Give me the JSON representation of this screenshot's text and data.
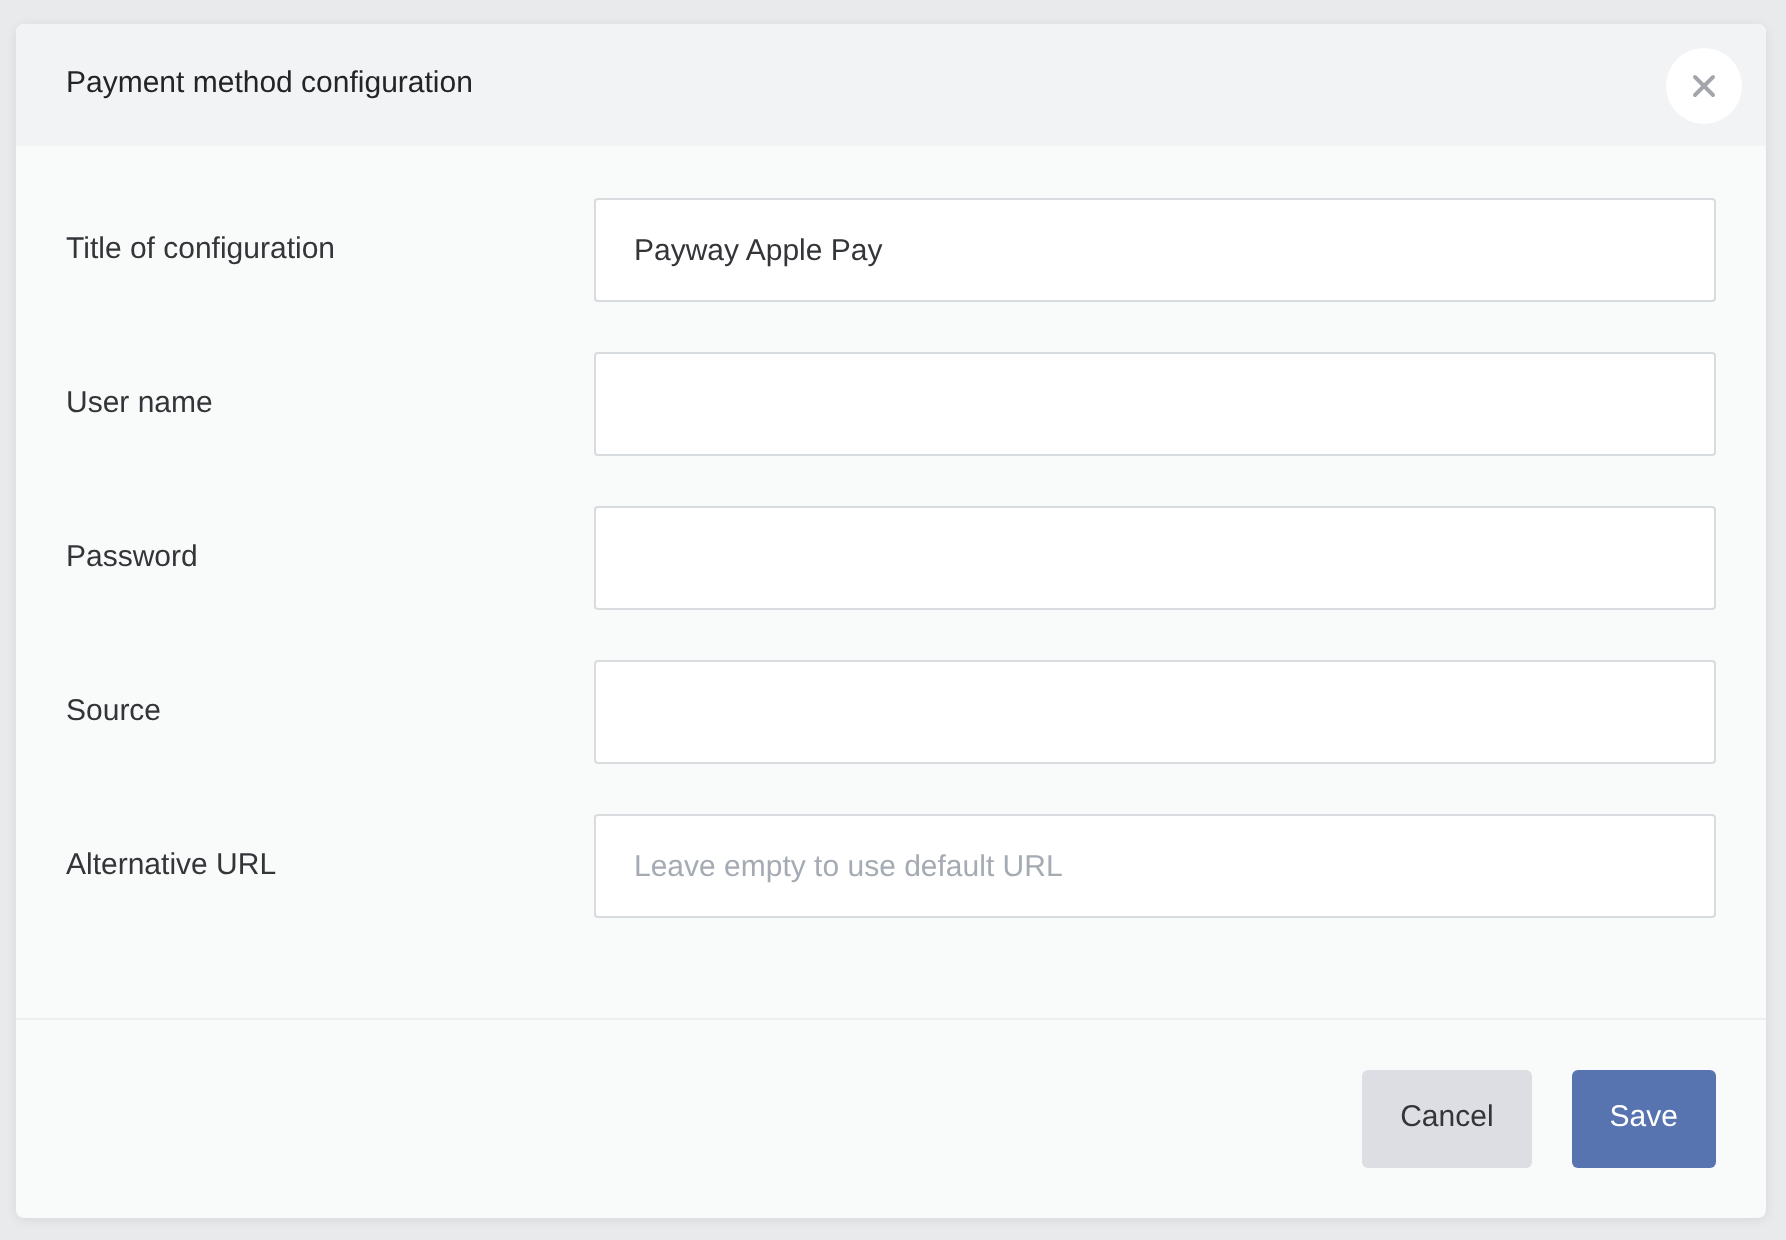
{
  "dialog": {
    "title": "Payment method configuration",
    "fields": [
      {
        "label": "Title of configuration",
        "value": "Payway Apple Pay"
      },
      {
        "label": "User name"
      },
      {
        "label": "Password"
      },
      {
        "label": "Source"
      },
      {
        "label": "Alternative URL",
        "placeholder": "Leave empty to use default URL"
      }
    ],
    "buttons": [
      {
        "label": "Cancel",
        "kind": "secondary"
      },
      {
        "label": "Save",
        "kind": "primary"
      }
    ]
  }
}
